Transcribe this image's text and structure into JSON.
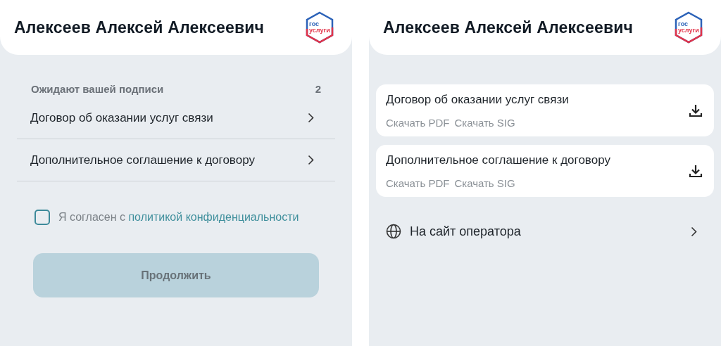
{
  "signing_screen": {
    "header": {
      "title": "Алексеев Алексей Алексеевич",
      "logo": [
        "гос",
        "услуги"
      ]
    },
    "section": {
      "title": "Ожидают вашей подписи",
      "count": "2"
    },
    "documents": [
      {
        "title": "Договор об оказании услуг связи"
      },
      {
        "title": "Дополнительное соглашение к договору"
      }
    ],
    "consent": {
      "text": "Я согласен с",
      "link": "политикой конфиденциальности",
      "checked": false
    },
    "continue_button": {
      "label": "Продолжить",
      "disabled": true
    }
  },
  "documents_screen": {
    "header": {
      "title": "Алексеев Алексей Алексеевич",
      "logo": [
        "гос",
        "услуги"
      ]
    },
    "documents": [
      {
        "title": "Договор об оказании услуг связи",
        "links": [
          "Скачать PDF",
          "Скачать SIG"
        ]
      },
      {
        "title": "Дополнительное соглашение к договору",
        "links": [
          "Скачать PDF",
          "Скачать SIG"
        ]
      }
    ],
    "operator_link": {
      "label": "На сайт оператора"
    }
  }
}
